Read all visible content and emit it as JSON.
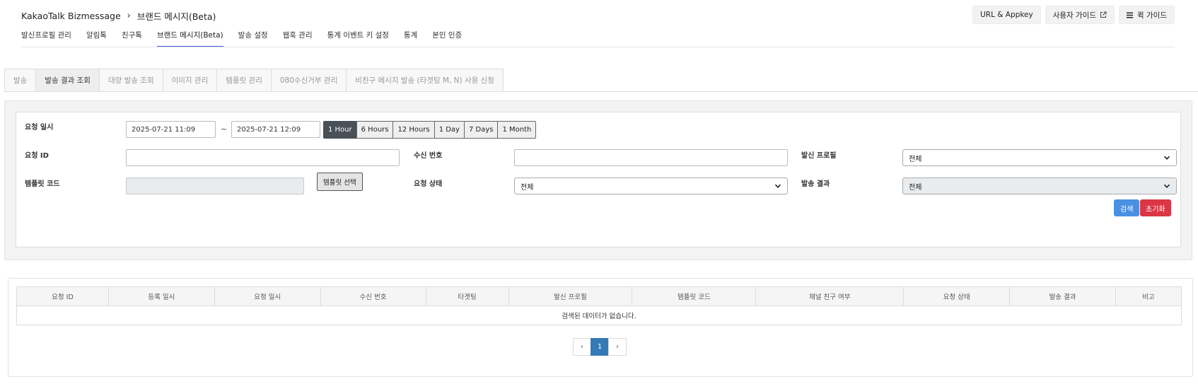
{
  "breadcrumb": {
    "root": "KakaoTalk Bizmessage",
    "separator": "›",
    "current": "브랜드 메시지(Beta)"
  },
  "top_actions": {
    "url_appkey": "URL & Appkey",
    "user_guide": "사용자 가이드",
    "quick_guide": "퀵 가이드"
  },
  "main_nav": [
    "발신프로필 관리",
    "알림톡",
    "친구톡",
    "브랜드 메시지(Beta)",
    "발송 설정",
    "웹훅 관리",
    "통계 이벤트 키 설정",
    "통계",
    "본인 인증"
  ],
  "main_nav_active": "브랜드 메시지(Beta)",
  "sub_tabs": [
    "발송",
    "발송 결과 조회",
    "대량 발송 조회",
    "이미지 관리",
    "템플릿 관리",
    "080수신거부 관리",
    "비친구 메시지 발송 (타겟팅 M, N) 사용 신청"
  ],
  "sub_tab_active": "발송 결과 조회",
  "search": {
    "request_datetime_label": "요청 일시",
    "date_from": "2025-07-21 11:09",
    "date_tilde": "~",
    "date_to": "2025-07-21 12:09",
    "ranges": [
      "1 Hour",
      "6 Hours",
      "12 Hours",
      "1 Day",
      "7 Days",
      "1 Month"
    ],
    "range_active": "1 Hour",
    "request_id_label": "요청 ID",
    "request_id_value": "",
    "recipient_label": "수신 번호",
    "recipient_value": "",
    "sender_profile_label": "발신 프로필",
    "sender_profile_value": "전체",
    "template_code_label": "템플릿 코드",
    "template_code_value": "",
    "template_select_button": "템플릿 선택",
    "request_status_label": "요청 상태",
    "request_status_value": "전체",
    "send_result_label": "발송 결과",
    "send_result_value": "전체",
    "search_button": "검색",
    "reset_button": "초기화"
  },
  "results": {
    "columns": [
      "요청 ID",
      "등록 일시",
      "요청 일시",
      "수신 번호",
      "타겟팅",
      "발신 프로필",
      "템플릿 코드",
      "채널 친구 여부",
      "요청 상태",
      "발송 결과",
      "비고"
    ],
    "empty_message": "검색된 데이터가 없습니다."
  },
  "pagination": {
    "prev": "‹",
    "current_page": "1",
    "next": "›"
  }
}
